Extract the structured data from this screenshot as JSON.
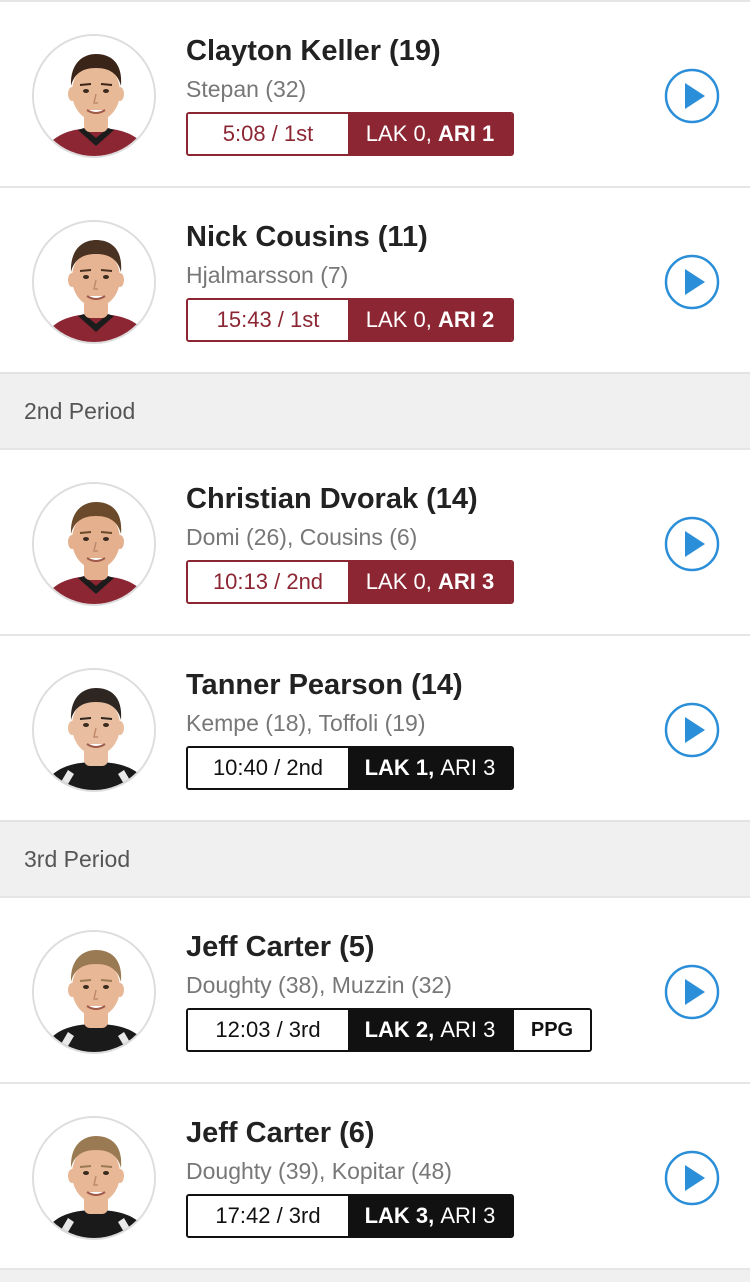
{
  "colors": {
    "ari": "#8c2633",
    "lak": "#111111",
    "play": "#2a8fd8"
  },
  "rows": [
    {
      "kind": "goal",
      "scorer": "Clayton Keller (19)",
      "assists": "Stepan (32)",
      "time": "5:08 / 1st",
      "score": [
        {
          "team": "LAK 0",
          "lead": false
        },
        {
          "team": "ARI 1",
          "lead": true
        }
      ],
      "team": "ari",
      "tag": null,
      "hair": "#3a2418",
      "skin": "#e8b997",
      "jersey": "red"
    },
    {
      "kind": "goal",
      "scorer": "Nick Cousins (11)",
      "assists": "Hjalmarsson (7)",
      "time": "15:43 / 1st",
      "score": [
        {
          "team": "LAK 0",
          "lead": false
        },
        {
          "team": "ARI 2",
          "lead": true
        }
      ],
      "team": "ari",
      "tag": null,
      "hair": "#4a3222",
      "skin": "#e6b493",
      "jersey": "red"
    },
    {
      "kind": "period",
      "label": "2nd Period"
    },
    {
      "kind": "goal",
      "scorer": "Christian Dvorak (14)",
      "assists": "Domi (26), Cousins (6)",
      "time": "10:13 / 2nd",
      "score": [
        {
          "team": "LAK 0",
          "lead": false
        },
        {
          "team": "ARI 3",
          "lead": true
        }
      ],
      "team": "ari",
      "tag": null,
      "hair": "#6a4a2a",
      "skin": "#e4b08e",
      "jersey": "red"
    },
    {
      "kind": "goal",
      "scorer": "Tanner Pearson (14)",
      "assists": "Kempe (18), Toffoli (19)",
      "time": "10:40 / 2nd",
      "score": [
        {
          "team": "LAK 1",
          "lead": true
        },
        {
          "team": "ARI 3",
          "lead": false
        }
      ],
      "team": "lak",
      "tag": null,
      "hair": "#2e2620",
      "skin": "#e9bea0",
      "jersey": "black"
    },
    {
      "kind": "period",
      "label": "3rd Period"
    },
    {
      "kind": "goal",
      "scorer": "Jeff Carter (5)",
      "assists": "Doughty (38), Muzzin (32)",
      "time": "12:03 / 3rd",
      "score": [
        {
          "team": "LAK 2",
          "lead": true
        },
        {
          "team": "ARI 3",
          "lead": false
        }
      ],
      "team": "lak",
      "tag": "PPG",
      "hair": "#9a7a52",
      "skin": "#e7b796",
      "jersey": "black"
    },
    {
      "kind": "goal",
      "scorer": "Jeff Carter (6)",
      "assists": "Doughty (39), Kopitar (48)",
      "time": "17:42 / 3rd",
      "score": [
        {
          "team": "LAK 3",
          "lead": true
        },
        {
          "team": "ARI 3",
          "lead": false
        }
      ],
      "team": "lak",
      "tag": null,
      "hair": "#9a7a52",
      "skin": "#e7b796",
      "jersey": "black"
    }
  ]
}
